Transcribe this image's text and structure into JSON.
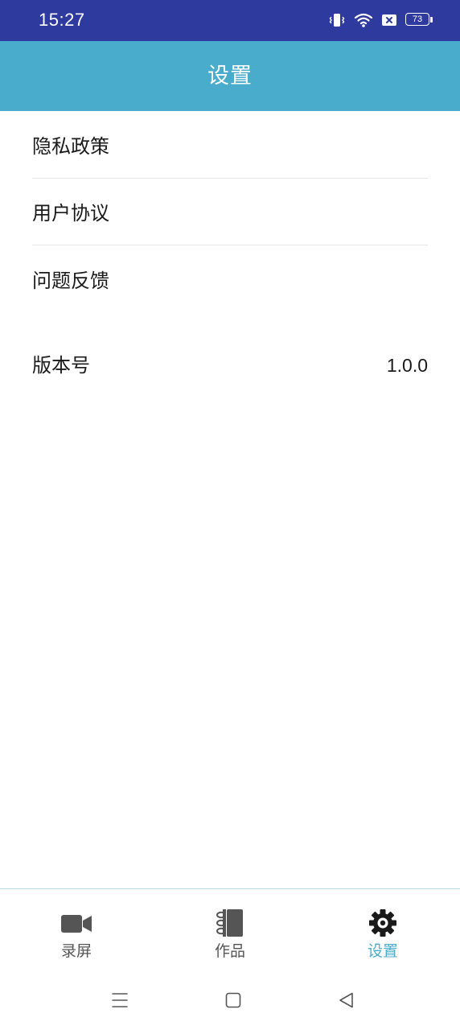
{
  "status_bar": {
    "time": "15:27",
    "battery_level": "73",
    "icons": [
      "vibrate-icon",
      "wifi-icon",
      "sim-error-icon",
      "battery-icon"
    ]
  },
  "header": {
    "title": "设置"
  },
  "menu": {
    "items": [
      {
        "label": "隐私政策"
      },
      {
        "label": "用户协议"
      },
      {
        "label": "问题反馈"
      }
    ]
  },
  "version": {
    "label": "版本号",
    "value": "1.0.0"
  },
  "bottom_nav": {
    "tabs": [
      {
        "label": "录屏",
        "icon": "video-camera-icon"
      },
      {
        "label": "作品",
        "icon": "notebook-icon"
      },
      {
        "label": "设置",
        "icon": "gear-icon"
      }
    ],
    "active_tab": "设置"
  },
  "colors": {
    "status_bar": "#2f3a9e",
    "header": "#4aaccd",
    "accent": "#4aaccd",
    "text": "#1a1a1a",
    "tab_inactive": "#555555"
  },
  "system_nav": {
    "buttons": [
      "menu-icon",
      "home-icon",
      "back-icon"
    ]
  }
}
